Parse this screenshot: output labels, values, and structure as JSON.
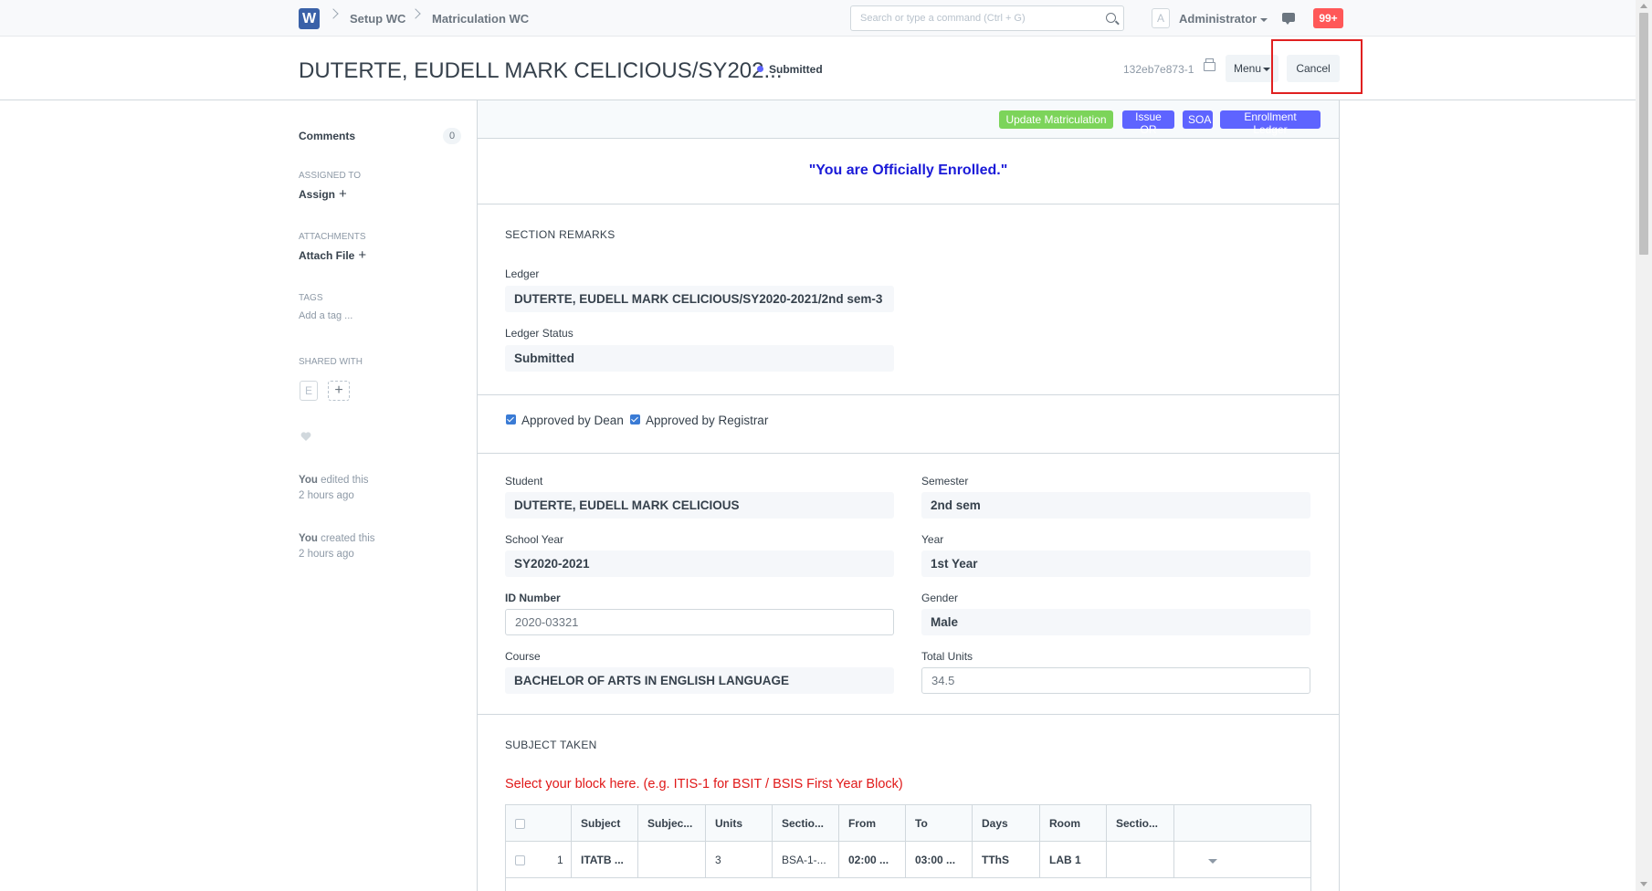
{
  "navbar": {
    "logo": "W",
    "breadcrumbs": [
      "Setup WC",
      "Matriculation WC"
    ],
    "search_placeholder": "Search or type a command (Ctrl + G)",
    "user_initial": "A",
    "user_name": "Administrator",
    "notifications": "99+"
  },
  "page_head": {
    "title": "DUTERTE, EUDELL MARK CELICIOUS/SY202...",
    "status": "Submitted",
    "doc_id": "132eb7e873-1",
    "menu_label": "Menu",
    "cancel_label": "Cancel"
  },
  "sidebar": {
    "comments_label": "Comments",
    "comments_count": "0",
    "assigned_to_label": "ASSIGNED TO",
    "assign_label": "Assign",
    "attachments_label": "ATTACHMENTS",
    "attach_label": "Attach File",
    "tags_label": "TAGS",
    "add_tag": "Add a tag ...",
    "shared_with_label": "SHARED WITH",
    "shared_initial": "E",
    "activity": [
      {
        "who": "You",
        "action": "edited this",
        "when": "2 hours ago"
      },
      {
        "who": "You",
        "action": "created this",
        "when": "2 hours ago"
      }
    ]
  },
  "toolbar": {
    "buttons": [
      {
        "label": "Update Matriculation",
        "color": "#7cd45a"
      },
      {
        "label": "Issue OR",
        "color": "#5e64ff"
      },
      {
        "label": "SOA",
        "color": "#5e64ff"
      },
      {
        "label": "Enrollment Ledger",
        "color": "#5e64ff"
      }
    ]
  },
  "form": {
    "enrolled_message": "\"You are Officially Enrolled.\"",
    "section_remarks": "SECTION REMARKS",
    "ledger_label": "Ledger",
    "ledger_value": "DUTERTE, EUDELL MARK CELICIOUS/SY2020-2021/2nd sem-3",
    "ledger_status_label": "Ledger Status",
    "ledger_status_value": "Submitted",
    "approved_dean": "Approved by Dean",
    "approved_registrar": "Approved by Registrar",
    "student_label": "Student",
    "student_value": "DUTERTE, EUDELL MARK CELICIOUS",
    "semester_label": "Semester",
    "semester_value": "2nd sem",
    "school_year_label": "School Year",
    "school_year_value": "SY2020-2021",
    "year_label": "Year",
    "year_value": "1st Year",
    "id_number_label": "ID Number",
    "id_number_value": "2020-03321",
    "gender_label": "Gender",
    "gender_value": "Male",
    "course_label": "Course",
    "course_value": "BACHELOR OF ARTS IN ENGLISH LANGUAGE",
    "total_units_label": "Total Units",
    "total_units_value": "34.5",
    "subject_taken": "SUBJECT TAKEN",
    "block_hint": "Select your block here. (e.g. ITIS-1 for BSIT / BSIS First Year Block)"
  },
  "grid": {
    "headers": [
      "Subject",
      "Subjec...",
      "Units",
      "Sectio...",
      "From",
      "To",
      "Days",
      "Room",
      "Sectio..."
    ],
    "rows": [
      {
        "idx": "1",
        "subject": "ITATB ...",
        "subject_desc": "",
        "units": "3",
        "section": "BSA-1-...",
        "from": "02:00 ...",
        "to": "03:00 ...",
        "days": "TThS",
        "room": "LAB 1",
        "section2": ""
      }
    ]
  }
}
